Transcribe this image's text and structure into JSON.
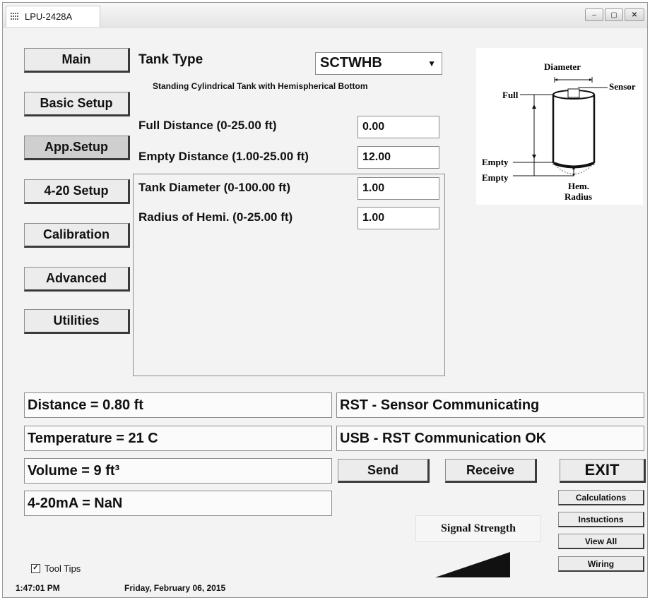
{
  "window": {
    "title": "LPU-2428A",
    "controls": {
      "minimize": "–",
      "maximize": "▢",
      "close": "✕"
    }
  },
  "nav": [
    {
      "label": "Main"
    },
    {
      "label": "Basic Setup"
    },
    {
      "label": "App.Setup",
      "active": true
    },
    {
      "label": "4-20 Setup"
    },
    {
      "label": "Calibration"
    },
    {
      "label": "Advanced"
    },
    {
      "label": "Utilities"
    }
  ],
  "app_setup": {
    "tank_type_label": "Tank Type",
    "tank_type_value": "SCTWHB",
    "tank_type_description": "Standing Cylindrical Tank with Hemispherical Bottom",
    "full_distance_label": "Full Distance (0-25.00 ft)",
    "full_distance_value": "0.00",
    "empty_distance_label": "Empty Distance (1.00-25.00 ft)",
    "empty_distance_value": "12.00",
    "tank_diameter_label": "Tank Diameter (0-100.00 ft)",
    "tank_diameter_value": "1.00",
    "radius_label": "Radius of Hemi. (0-25.00 ft)",
    "radius_value": "1.00"
  },
  "diagram": {
    "diameter": "Diameter",
    "sensor": "Sensor",
    "full": "Full",
    "empty1": "Empty",
    "empty2": "Empty",
    "hem1": "Hem.",
    "hem2": "Radius"
  },
  "readings": {
    "distance": "Distance = 0.80 ft",
    "temperature": "Temperature = 21 C",
    "volume": "Volume = 9 ft³",
    "current": "4-20mA = NaN"
  },
  "status": {
    "sensor": "RST - Sensor Communicating",
    "usb": "USB - RST Communication OK"
  },
  "buttons": {
    "send": "Send",
    "receive": "Receive",
    "exit": "EXIT",
    "calculations": "Calculations",
    "instructions": "Instuctions",
    "view_all": "View All",
    "wiring": "Wiring"
  },
  "signal": {
    "label": "Signal Strength"
  },
  "tooltips": {
    "label": "Tool Tips",
    "checked": true,
    "mark": "✓"
  },
  "footer": {
    "time": "1:47:01 PM",
    "date": "Friday, February 06, 2015"
  },
  "colors": {
    "background": "#f3f3f3",
    "button_face": "#ececec",
    "active_button": "#cfcfcf",
    "signal_fill": "#111111"
  }
}
